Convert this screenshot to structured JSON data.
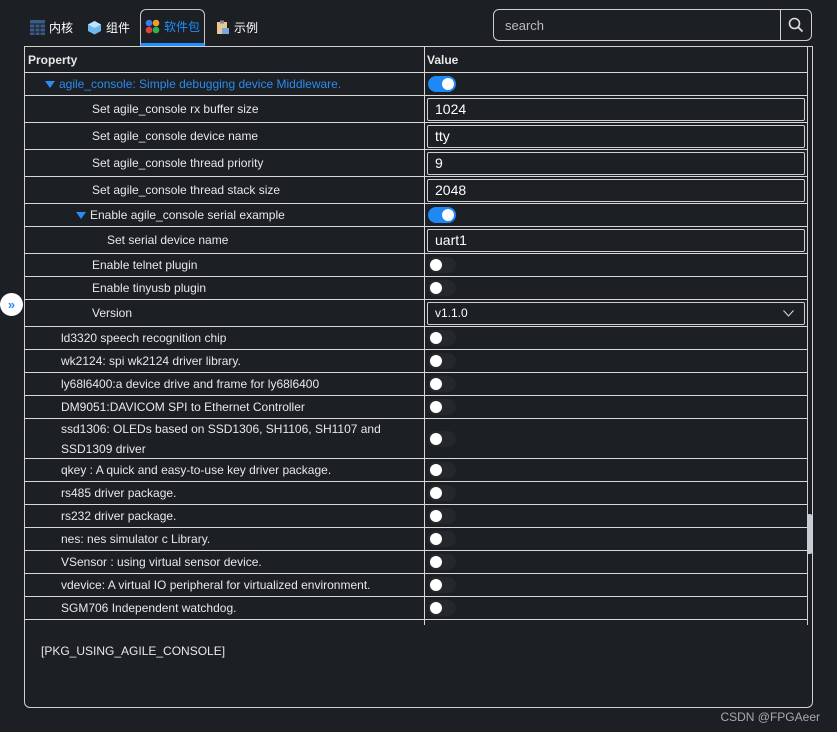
{
  "tabs": [
    {
      "label": "内核",
      "icon": "grid-icon"
    },
    {
      "label": "组件",
      "icon": "cube-icon"
    },
    {
      "label": "软件包",
      "icon": "packages-icon",
      "active": true
    },
    {
      "label": "示例",
      "icon": "clipboard-icon"
    }
  ],
  "search": {
    "placeholder": "search"
  },
  "table": {
    "headers": [
      "Property",
      "Value"
    ],
    "rows": [
      {
        "label": "agile_console: Simple debugging device Middleware.",
        "indent": 1,
        "expanded": true,
        "highlight": true,
        "type": "toggle",
        "value": true
      },
      {
        "label": "Set agile_console rx buffer size",
        "indent": 2,
        "type": "input",
        "value": "1024"
      },
      {
        "label": "Set agile_console device name",
        "indent": 2,
        "type": "input",
        "value": "tty"
      },
      {
        "label": "Set agile_console thread priority",
        "indent": 2,
        "type": "input",
        "value": "9"
      },
      {
        "label": "Set agile_console thread stack size",
        "indent": 2,
        "type": "input",
        "value": "2048"
      },
      {
        "label": "Enable agile_console serial example",
        "indent": 2,
        "expanded": true,
        "type": "toggle",
        "value": true
      },
      {
        "label": "Set serial device name",
        "indent": 3,
        "type": "input",
        "value": "uart1"
      },
      {
        "label": "Enable telnet plugin",
        "indent": 2,
        "type": "toggle",
        "value": false
      },
      {
        "label": "Enable tinyusb plugin",
        "indent": 2,
        "type": "toggle",
        "value": false
      },
      {
        "label": "Version",
        "indent": 2,
        "type": "select",
        "value": "v1.1.0"
      },
      {
        "label": "ld3320 speech recognition chip",
        "indent": 1,
        "type": "toggle",
        "value": false
      },
      {
        "label": "wk2124: spi wk2124 driver library.",
        "indent": 1,
        "type": "toggle",
        "value": false
      },
      {
        "label": "ly68l6400:a device drive and frame for ly68l6400",
        "indent": 1,
        "type": "toggle",
        "value": false
      },
      {
        "label": "DM9051:DAVICOM SPI to Ethernet Controller",
        "indent": 1,
        "type": "toggle",
        "value": false
      },
      {
        "label": "ssd1306: OLEDs based on SSD1306, SH1106, SH1107 and SSD1309 driver",
        "indent": 1,
        "type": "toggle",
        "value": false,
        "tall": true
      },
      {
        "label": "qkey : A quick and easy-to-use key driver package.",
        "indent": 1,
        "type": "toggle",
        "value": false
      },
      {
        "label": "rs485 driver package.",
        "indent": 1,
        "type": "toggle",
        "value": false
      },
      {
        "label": "rs232 driver package.",
        "indent": 1,
        "type": "toggle",
        "value": false
      },
      {
        "label": "nes: nes simulator c Library.",
        "indent": 1,
        "type": "toggle",
        "value": false
      },
      {
        "label": "VSensor : using virtual sensor device.",
        "indent": 1,
        "type": "toggle",
        "value": false
      },
      {
        "label": "vdevice: A virtual IO peripheral for virtualized environment.",
        "indent": 1,
        "type": "toggle",
        "value": false
      },
      {
        "label": "SGM706 Independent watchdog.",
        "indent": 1,
        "type": "toggle",
        "value": false
      }
    ]
  },
  "description": "[PKG_USING_AGILE_CONSOLE]",
  "watermark": "CSDN @FPGAeer",
  "colors": {
    "accent": "#1e88f5",
    "background": "#1c1f23"
  }
}
